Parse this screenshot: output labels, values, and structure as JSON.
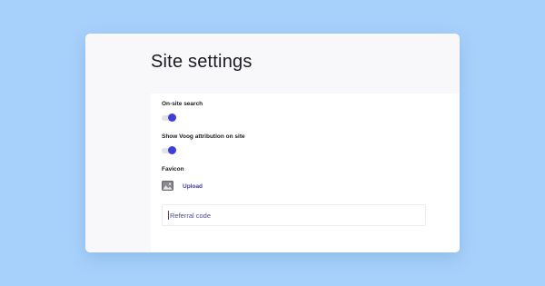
{
  "page": {
    "title": "Site settings"
  },
  "settings": {
    "onsite_search": {
      "label": "On-site search",
      "enabled": true
    },
    "voog_attribution": {
      "label": "Show Voog attribution on site",
      "enabled": true
    },
    "favicon": {
      "label": "Favicon",
      "icon": "image-icon",
      "upload_label": "Upload"
    },
    "referral": {
      "placeholder": "Referral code",
      "value": ""
    }
  },
  "colors": {
    "background": "#a7d1fb",
    "window": "#f8f8fa",
    "panel": "#ffffff",
    "accent": "#3d3fd6",
    "link": "#3f3f9c",
    "toggle_track": "#e1e1e6"
  }
}
